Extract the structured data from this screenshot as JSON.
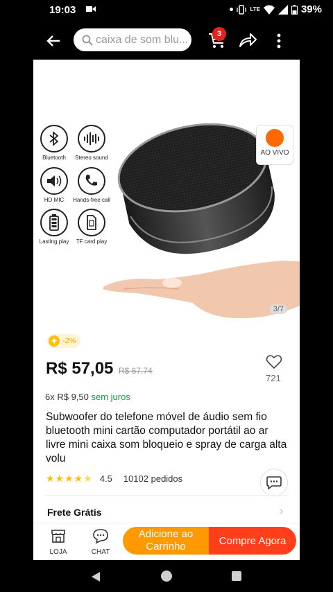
{
  "status": {
    "time": "19:03",
    "battery": "39%",
    "network": "LTE"
  },
  "appbar": {
    "search_placeholder": "caixa de som blu...",
    "cart_badge": "3"
  },
  "gallery": {
    "pager": "3/7",
    "live_label": "AO VIVO",
    "features": [
      {
        "icon": "bluetooth-icon",
        "label": "Bluetooth"
      },
      {
        "icon": "sound-wave-icon",
        "label": "Stereo sound"
      },
      {
        "icon": "speaker-mic-icon",
        "label": "HD MIC"
      },
      {
        "icon": "phone-call-icon",
        "label": "Hands-free call"
      },
      {
        "icon": "battery-icon",
        "label": "Lasting play"
      },
      {
        "icon": "sd-card-icon",
        "label": "TF card play"
      }
    ]
  },
  "product": {
    "discount": "-2%",
    "price": "R$ 57,05",
    "old_price": "R$ 67,74",
    "favorites": "721",
    "installments_prefix": "6x R$ 9,50",
    "installments_suffix": "sem juros",
    "title": "Subwoofer do telefone móvel de áudio sem fio bluetooth mini cartão computador portátil ao ar livre mini caixa som bloqueio e spray de carga alta volu",
    "rating": "4.5",
    "orders": "10102 pedidos",
    "rating_value": 4.5,
    "shipping": "Frete Grátis"
  },
  "actions": {
    "store_label": "LOJA",
    "chat_label": "CHAT",
    "add_to_cart": "Adicione ao Carrinho",
    "buy_now": "Compre Agora"
  },
  "colors": {
    "accent_orange": "#ff9900",
    "accent_red": "#ff3e1a",
    "green": "#00a250",
    "star": "#ffbf00"
  }
}
